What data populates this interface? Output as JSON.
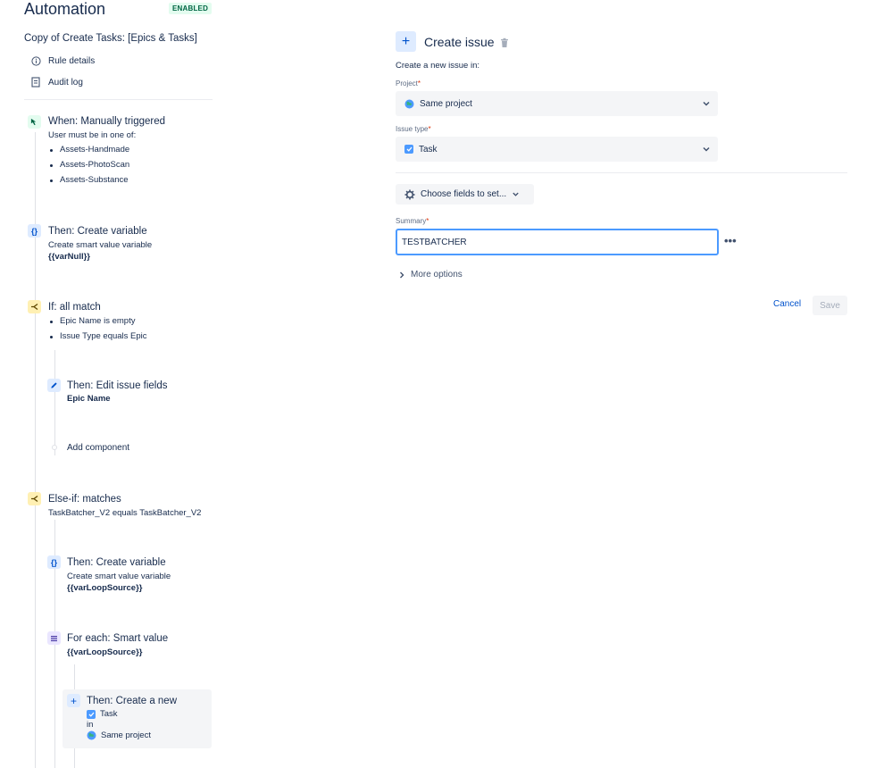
{
  "header": {
    "title": "Automation",
    "badge": "ENABLED"
  },
  "sidebar": {
    "rule_name": "Copy of Create Tasks: [Epics & Tasks]",
    "links": [
      {
        "label": "Rule details",
        "icon": "info-icon"
      },
      {
        "label": "Audit log",
        "icon": "document-icon"
      }
    ]
  },
  "rule": {
    "trigger": {
      "title": "When: Manually triggered",
      "subtitle": "User must be in one of:",
      "groups": [
        "Assets-Handmade",
        "Assets-PhotoScan",
        "Assets-Substance"
      ]
    },
    "create_variable_1": {
      "title": "Then: Create variable",
      "subtitle": "Create smart value variable",
      "value": "{{varNull}}"
    },
    "if_condition": {
      "title": "If: all match",
      "conditions": [
        "Epic Name is empty",
        "Issue Type equals Epic"
      ]
    },
    "edit_fields": {
      "title": "Then: Edit issue fields",
      "value": "Epic Name"
    },
    "add_component": {
      "label": "Add component"
    },
    "else_if": {
      "title": "Else-if: matches",
      "subtitle": "TaskBatcher_V2 equals TaskBatcher_V2"
    },
    "create_variable_2": {
      "title": "Then: Create variable",
      "subtitle": "Create smart value variable",
      "value": "{{varLoopSource}}"
    },
    "for_each": {
      "title": "For each: Smart value",
      "value": "{{varLoopSource}}"
    },
    "create_new": {
      "title": "Then: Create a new",
      "issue_type": "Task",
      "in_label": "in",
      "project": "Same project"
    }
  },
  "panel": {
    "title": "Create issue",
    "intro": "Create a new issue in:",
    "project": {
      "label": "Project",
      "required_mark": "*",
      "value": "Same project"
    },
    "issue_type": {
      "label": "Issue type",
      "required_mark": "*",
      "value": "Task"
    },
    "choose_fields": {
      "label": "Choose fields to set..."
    },
    "summary": {
      "label": "Summary",
      "required_mark": "*",
      "value": "TESTBATCHER"
    },
    "more_options": "More options",
    "cancel": "Cancel",
    "save": "Save"
  },
  "colors": {
    "accent": "#0052cc",
    "focus": "#4c9aff",
    "enabled_bg": "#e3fcef",
    "enabled_fg": "#006644"
  }
}
